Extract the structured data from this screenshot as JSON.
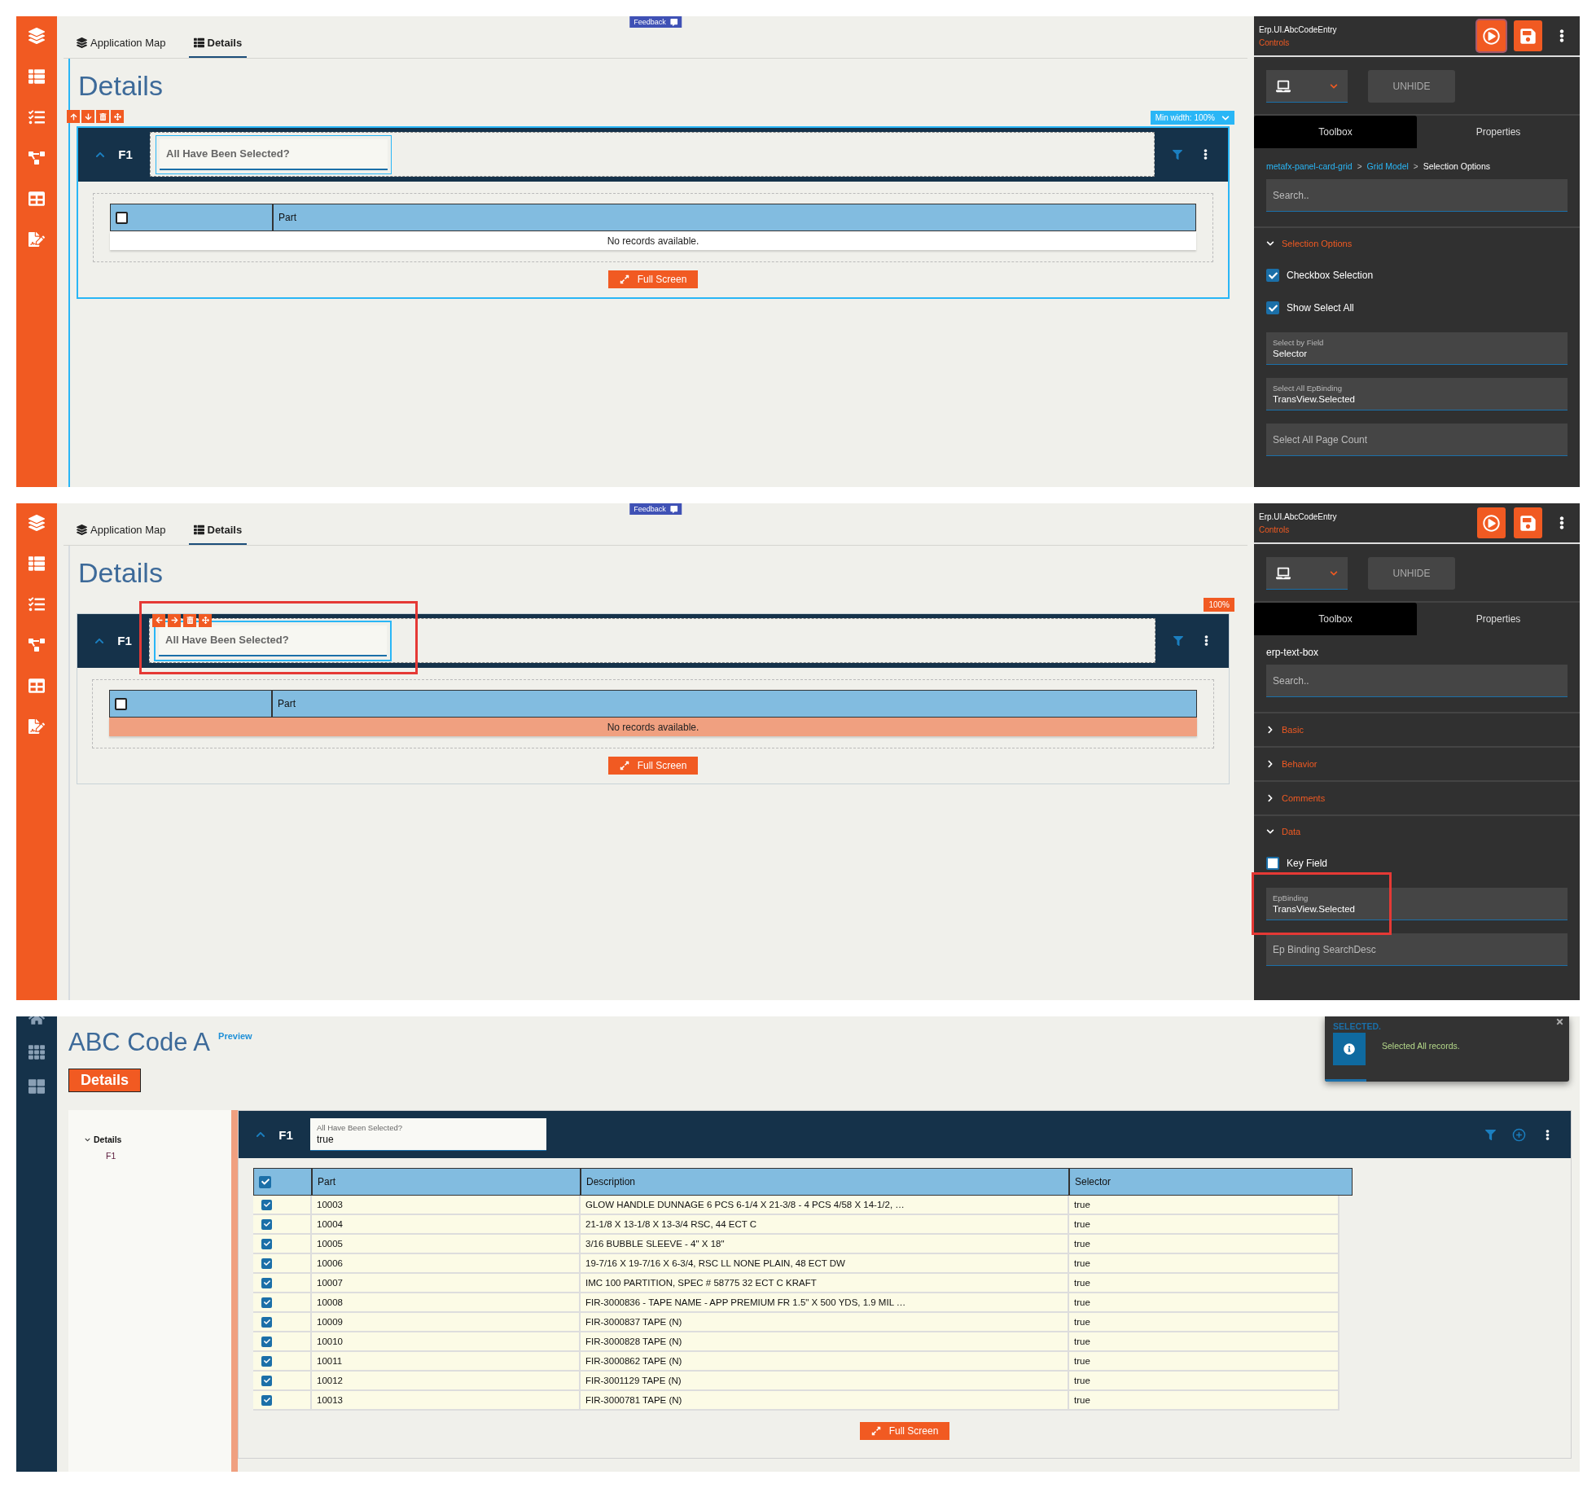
{
  "designer_views": [
    {
      "nav_tabs": [
        {
          "label": "Application Map",
          "selected": false
        },
        {
          "label": "Details",
          "selected": true
        }
      ],
      "feedback": "Feedback",
      "page_title": "Details",
      "width_badge": "Min width: 100%",
      "card": {
        "selected": true,
        "title": "F1",
        "field": {
          "placeholder": "All Have Been Selected?",
          "selected": false,
          "highlighted": false
        },
        "grid": {
          "columns": [
            "Part"
          ],
          "select_all_checked": false,
          "empty_text": "No records available.",
          "empty_highlighted": false
        },
        "full_screen": "Full Screen"
      },
      "panel": {
        "app": "Erp.UI.AbcCodeEntry",
        "subtitle": "Controls",
        "run_focused": true,
        "unhide": "UNHIDE",
        "tabs": [
          {
            "label": "Toolbox",
            "selected": true
          },
          {
            "label": "Properties",
            "selected": false
          }
        ],
        "breadcrumb": [
          "metafx-panel-card-grid",
          "Grid Model",
          "Selection Options"
        ],
        "breadcrumb_separator": ">",
        "search_placeholder": "Search..",
        "items": [
          {
            "kind": "section",
            "label": "Selection Options",
            "expanded": true
          },
          {
            "kind": "checkbox",
            "label": "Checkbox Selection",
            "checked": true
          },
          {
            "kind": "checkbox",
            "label": "Show Select All",
            "checked": true
          },
          {
            "kind": "field",
            "label": "Select by Field",
            "value": "Selector",
            "highlighted": false
          },
          {
            "kind": "field",
            "label": "Select All EpBinding",
            "value": "TransView.Selected",
            "highlighted": false
          },
          {
            "kind": "field",
            "placeholder": "Select All Page Count",
            "highlighted": false
          }
        ]
      }
    },
    {
      "nav_tabs": [
        {
          "label": "Application Map",
          "selected": false
        },
        {
          "label": "Details",
          "selected": true
        }
      ],
      "feedback": "Feedback",
      "page_title": "Details",
      "width_badge": "100%",
      "card": {
        "selected": false,
        "title": "F1",
        "field": {
          "placeholder": "All Have Been Selected?",
          "selected": true,
          "highlighted": true
        },
        "grid": {
          "columns": [
            "Part"
          ],
          "select_all_checked": false,
          "empty_text": "No records available.",
          "empty_highlighted": true
        },
        "full_screen": "Full Screen"
      },
      "panel": {
        "app": "Erp.UI.AbcCodeEntry",
        "subtitle": "Controls",
        "run_focused": false,
        "unhide": "UNHIDE",
        "tabs": [
          {
            "label": "Toolbox",
            "selected": true
          },
          {
            "label": "Properties",
            "selected": false
          }
        ],
        "heading": "erp-text-box",
        "search_placeholder": "Search..",
        "items": [
          {
            "kind": "section",
            "label": "Basic",
            "expanded": false
          },
          {
            "kind": "section",
            "label": "Behavior",
            "expanded": false
          },
          {
            "kind": "section",
            "label": "Comments",
            "expanded": false
          },
          {
            "kind": "section",
            "label": "Data",
            "expanded": true
          },
          {
            "kind": "checkbox",
            "label": "Key Field",
            "checked": false
          },
          {
            "kind": "field",
            "label": "EpBinding",
            "value": "TransView.Selected",
            "highlighted": true
          },
          {
            "kind": "field",
            "placeholder": "Ep Binding SearchDesc",
            "highlighted": false
          }
        ]
      }
    }
  ],
  "preview": {
    "title": "ABC Code A",
    "badge": "Preview",
    "page_button": "Details",
    "tree": [
      {
        "label": "Details",
        "expanded": true,
        "children": [
          {
            "label": "F1"
          }
        ]
      }
    ],
    "card": {
      "title": "F1",
      "field": {
        "label": "All Have Been Selected?",
        "value": "true"
      },
      "grid": {
        "select_all_checked": true,
        "columns": [
          "Part",
          "Description",
          "Selector"
        ],
        "rows": [
          {
            "checked": true,
            "cells": [
              "10003",
              "GLOW HANDLE DUNNAGE 6 PCS 6-1/4 X 21-3/8 - 4 PCS 4/58 X 14-1/2, …",
              "true"
            ]
          },
          {
            "checked": true,
            "cells": [
              "10004",
              "21-1/8 X 13-1/8 X 13-3/4 RSC, 44 ECT C",
              "true"
            ]
          },
          {
            "checked": true,
            "cells": [
              "10005",
              "3/16 BUBBLE SLEEVE - 4\" X 18\"",
              "true"
            ]
          },
          {
            "checked": true,
            "cells": [
              "10006",
              "19-7/16 X 19-7/16 X 6-3/4, RSC LL NONE PLAIN, 48 ECT DW",
              "true"
            ]
          },
          {
            "checked": true,
            "cells": [
              "10007",
              "IMC 100 PARTITION, SPEC # 58775 32 ECT C KRAFT",
              "true"
            ]
          },
          {
            "checked": true,
            "cells": [
              "10008",
              "FIR-3000836 - TAPE NAME - APP PREMIUM FR 1.5\" X 500 YDS, 1.9 MIL …",
              "true"
            ]
          },
          {
            "checked": true,
            "cells": [
              "10009",
              "FIR-3000837 TAPE (N)",
              "true"
            ]
          },
          {
            "checked": true,
            "cells": [
              "10010",
              "FIR-3000828 TAPE (N)",
              "true"
            ]
          },
          {
            "checked": true,
            "cells": [
              "10011",
              "FIR-3000862 TAPE (N)",
              "true"
            ]
          },
          {
            "checked": true,
            "cells": [
              "10012",
              "FIR-3001129 TAPE (N)",
              "true"
            ]
          },
          {
            "checked": true,
            "cells": [
              "10013",
              "FIR-3000781 TAPE (N)",
              "true"
            ]
          }
        ]
      },
      "full_screen": "Full Screen"
    },
    "toast": {
      "title": "SELECTED.",
      "message": "Selected All records.",
      "level": 0.17
    }
  }
}
